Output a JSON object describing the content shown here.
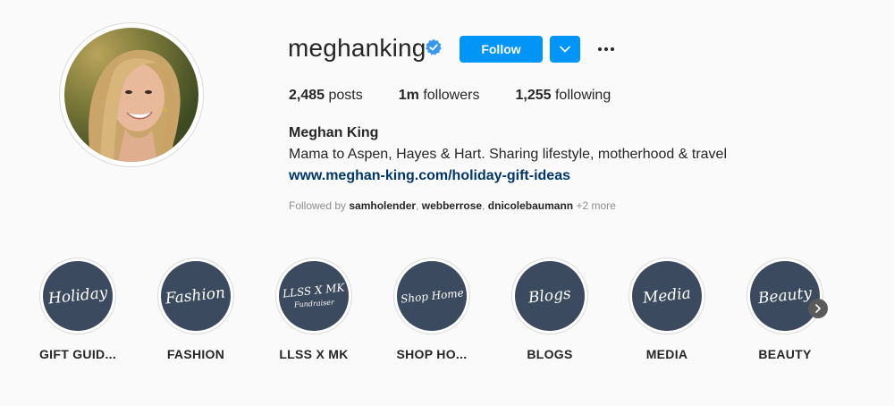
{
  "profile": {
    "username": "meghanking",
    "verified": true,
    "avatar_alt": "avatar",
    "full_name": "Meghan King",
    "bio": "Mama to Aspen, Hayes & Hart. Sharing lifestyle, motherhood & travel",
    "link": "www.meghan-king.com/holiday-gift-ideas"
  },
  "actions": {
    "follow_label": "Follow",
    "dropdown_icon": "chevron-down-icon",
    "more_icon": "more-options-icon"
  },
  "stats": {
    "posts_count": "2,485",
    "posts_label": "posts",
    "followers_count": "1m",
    "followers_label": "followers",
    "following_count": "1,255",
    "following_label": "following"
  },
  "followed_by": {
    "prefix": "Followed by",
    "users": [
      "samholender",
      "webberrose",
      "dnicolebaumann"
    ],
    "more": "+2 more"
  },
  "highlights": [
    {
      "cover_text": "Holiday",
      "cover_sub": "",
      "label": "GIFT GUID..."
    },
    {
      "cover_text": "Fashion",
      "cover_sub": "",
      "label": "FASHION"
    },
    {
      "cover_text": "LLSS X MK",
      "cover_sub": "Fundraiser",
      "label": "LLSS X MK"
    },
    {
      "cover_text": "Shop Home",
      "cover_sub": "",
      "label": "SHOP HO..."
    },
    {
      "cover_text": "Blogs",
      "cover_sub": "",
      "label": "BLOGS"
    },
    {
      "cover_text": "Media",
      "cover_sub": "",
      "label": "MEDIA"
    },
    {
      "cover_text": "Beauty",
      "cover_sub": "",
      "label": "BEAUTY"
    }
  ],
  "colors": {
    "accent": "#0095f6",
    "link": "#00376b",
    "highlight_bg": "#3b4a5e",
    "background": "#fafafa"
  }
}
